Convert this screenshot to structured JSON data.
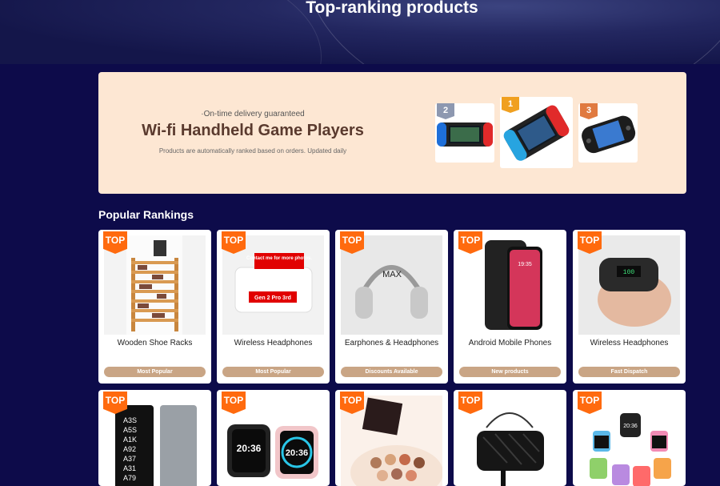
{
  "hero": {
    "title": "Top-ranking products"
  },
  "banner": {
    "subtitle": "·On-time delivery guaranteed",
    "title": "Wi-fi Handheld Game Players",
    "note": "Products are automatically ranked based on orders. Updated daily",
    "ranks": [
      "2",
      "1",
      "3"
    ]
  },
  "section": {
    "title": "Popular Rankings"
  },
  "top_label": "TOP",
  "cards_row1": [
    {
      "name": "Wooden Shoe Racks",
      "pill": "Most Popular"
    },
    {
      "name": "Wireless Headphones",
      "pill": "Most Popular",
      "img_text1": "Contact me for more photos.",
      "img_text2": "Gen 2 Pro 3rd"
    },
    {
      "name": "Earphones & Headphones",
      "pill": "Discounts Available",
      "img_text1": "MAX"
    },
    {
      "name": "Android Mobile Phones",
      "pill": "New products",
      "img_text1": "19:35"
    },
    {
      "name": "Wireless Headphones",
      "pill": "Fast Dispatch",
      "img_text1": "100"
    }
  ],
  "cards_row2": [
    {
      "img_lines": [
        "A3S",
        "A5S",
        "A1K",
        "A92",
        "A37",
        "A31",
        "A79"
      ]
    },
    {
      "img_text1": "20:36",
      "img_text2": "20:36"
    },
    {},
    {},
    {
      "img_text1": "20:36"
    }
  ],
  "colors": {
    "accent": "#ff6a0e",
    "pill": "#c9a585",
    "background": "#0d0b4a",
    "banner": "#fde7d3"
  }
}
